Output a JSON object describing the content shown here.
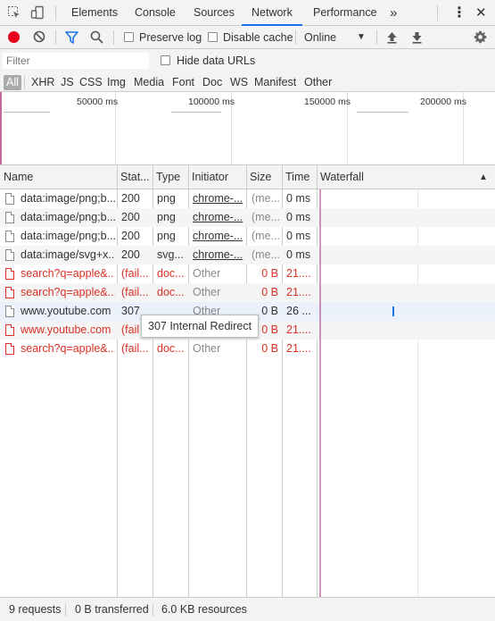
{
  "tabs": [
    {
      "label": "Elements",
      "active": false
    },
    {
      "label": "Console",
      "active": false
    },
    {
      "label": "Sources",
      "active": false
    },
    {
      "label": "Network",
      "active": true
    },
    {
      "label": "Performance",
      "active": false
    }
  ],
  "toolbar": {
    "preserve_log": "Preserve log",
    "disable_cache": "Disable cache",
    "throttling": "Online"
  },
  "filter": {
    "placeholder": "Filter",
    "hide_data_urls": "Hide data URLs",
    "types": [
      "All",
      "XHR",
      "JS",
      "CSS",
      "Img",
      "Media",
      "Font",
      "Doc",
      "WS",
      "Manifest",
      "Other"
    ]
  },
  "overview": {
    "ticks": [
      "50000 ms",
      "100000 ms",
      "150000 ms",
      "200000 ms"
    ]
  },
  "columns": [
    "Name",
    "Stat...",
    "Type",
    "Initiator",
    "Size",
    "Time",
    "Waterfall"
  ],
  "rows": [
    {
      "name": "data:image/png;b...",
      "status": "200",
      "type": "png",
      "initiator": "chrome-...",
      "size": "(me...",
      "time": "0 ms",
      "error": false
    },
    {
      "name": "data:image/png;b...",
      "status": "200",
      "type": "png",
      "initiator": "chrome-...",
      "size": "(me...",
      "time": "0 ms",
      "error": false
    },
    {
      "name": "data:image/png;b...",
      "status": "200",
      "type": "png",
      "initiator": "chrome-...",
      "size": "(me...",
      "time": "0 ms",
      "error": false
    },
    {
      "name": "data:image/svg+x...",
      "status": "200",
      "type": "svg...",
      "initiator": "chrome-...",
      "size": "(me...",
      "time": "0 ms",
      "error": false
    },
    {
      "name": "search?q=apple&...",
      "status": "(fail...",
      "type": "doc...",
      "initiator": "Other",
      "size": "0 B",
      "time": "21....",
      "error": true
    },
    {
      "name": "search?q=apple&...",
      "status": "(fail...",
      "type": "doc...",
      "initiator": "Other",
      "size": "0 B",
      "time": "21....",
      "error": true
    },
    {
      "name": "www.youtube.com",
      "status": "307",
      "type": "",
      "initiator": "Other",
      "size": "0 B",
      "time": "26 ...",
      "error": false
    },
    {
      "name": "www.youtube.com",
      "status": "(fail",
      "type": "",
      "initiator": "",
      "size": "0 B",
      "time": "21....",
      "error": true
    },
    {
      "name": "search?q=apple&...",
      "status": "(fail...",
      "type": "doc...",
      "initiator": "Other",
      "size": "0 B",
      "time": "21....",
      "error": true
    }
  ],
  "tooltip": "307 Internal Redirect",
  "status": {
    "requests": "9 requests",
    "transferred": "0 B transferred",
    "resources": "6.0 KB resources"
  },
  "colors": {
    "accent": "#1a73e8",
    "error": "#d93025",
    "record": "#e8001c"
  }
}
